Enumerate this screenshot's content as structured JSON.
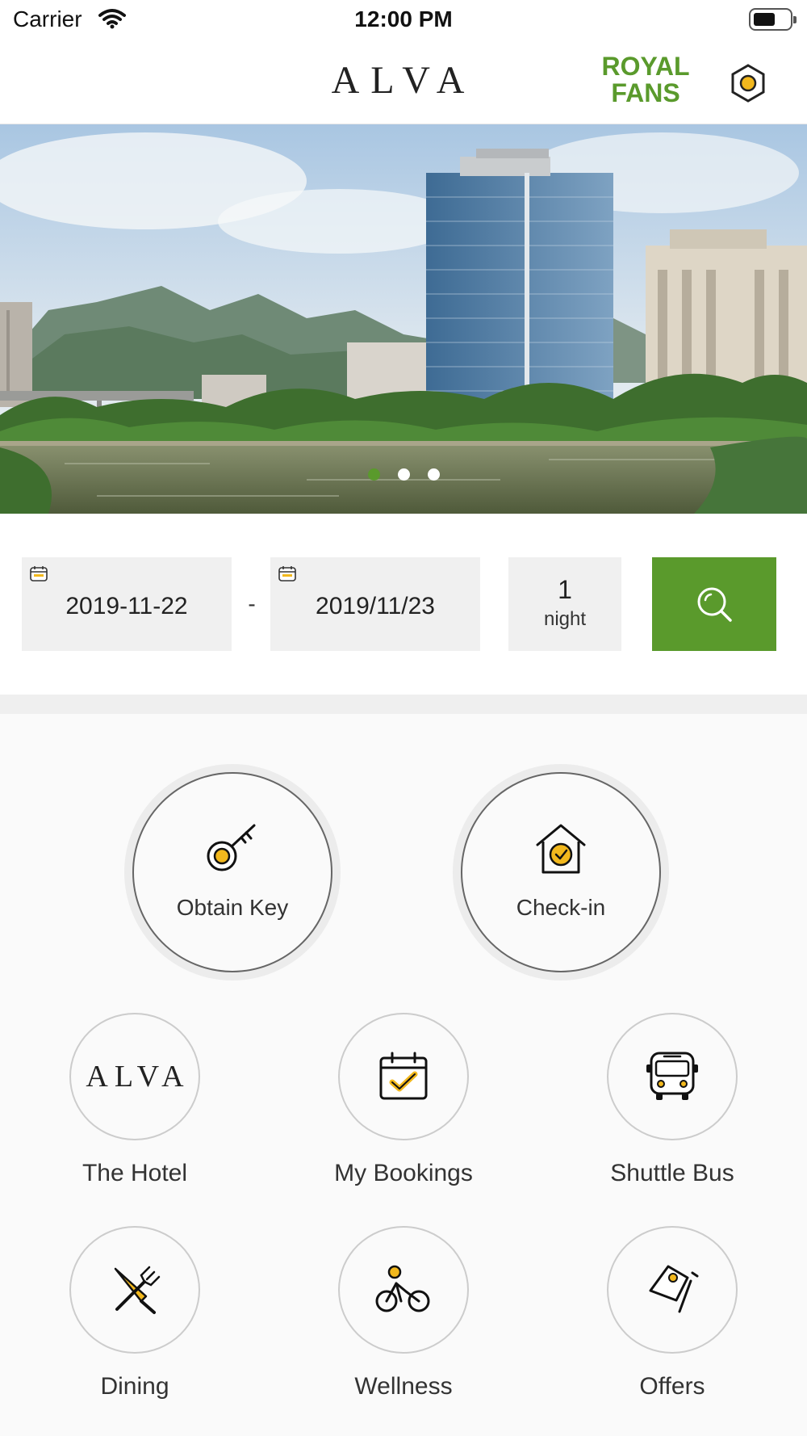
{
  "status_bar": {
    "carrier": "Carrier",
    "time": "12:00 PM"
  },
  "header": {
    "logo": "ALVA",
    "royal_fans": "ROYAL FANS",
    "settings_icon": "hexagon-settings-icon"
  },
  "hero": {
    "image_desc_icon": "hotel-photo",
    "slide_count": 3,
    "active_slide": 1
  },
  "booking": {
    "check_in": "2019-11-22",
    "separator": "-",
    "check_out": "2019/11/23",
    "nights_count": "1",
    "nights_label": "night",
    "search_icon": "search-icon"
  },
  "primary_actions": [
    {
      "label": "Obtain Key",
      "icon": "key-icon"
    },
    {
      "label": "Check-in",
      "icon": "house-check-icon"
    }
  ],
  "tiles": [
    {
      "label": "The Hotel",
      "icon": "alva-logo",
      "logo_text": "ALVA"
    },
    {
      "label": "My Bookings",
      "icon": "calendar-check-icon"
    },
    {
      "label": "Shuttle Bus",
      "icon": "bus-icon"
    },
    {
      "label": "Dining",
      "icon": "fork-knife-icon"
    },
    {
      "label": "Wellness",
      "icon": "cyclist-icon"
    },
    {
      "label": "Offers",
      "icon": "coupon-icon"
    }
  ],
  "colors": {
    "brand_green": "#5a9a2c",
    "accent_yellow": "#f2b81d"
  }
}
